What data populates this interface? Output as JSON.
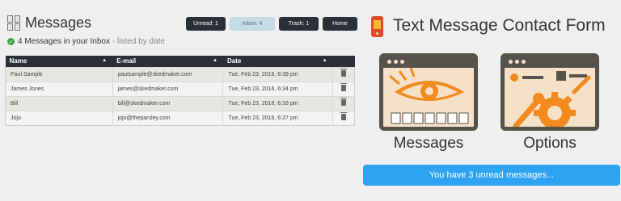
{
  "header": {
    "title": "Messages"
  },
  "nav": {
    "unread": "Unread: 1",
    "inbox": "Inbox: 4",
    "trash": "Trash: 1",
    "home": "Home"
  },
  "status": {
    "main": "4 Messages in your Inbox",
    "suffix": "- listed by date"
  },
  "table": {
    "columns": [
      "Name",
      "E-mail",
      "Date"
    ],
    "rows": [
      {
        "name": "Paul Sample",
        "email": "paulsample@skedmaker.com",
        "date": "Tue, Feb 23, 2016, 6:39 pm"
      },
      {
        "name": "James Jones",
        "email": "james@skedmaker.com",
        "date": "Tue, Feb 23, 2016, 6:34 pm"
      },
      {
        "name": "Bill",
        "email": "bill@skedmaker.com",
        "date": "Tue, Feb 23, 2016, 6:33 pm"
      },
      {
        "name": "Jojo",
        "email": "jojo@theparsley.com",
        "date": "Tue, Feb 23, 2016, 6:27 pm"
      }
    ]
  },
  "side": {
    "title": "Text Message Contact Form",
    "tiles": [
      {
        "label": "Messages",
        "icon": "eye-envelopes-icon"
      },
      {
        "label": "Options",
        "icon": "gears-icon"
      }
    ],
    "notice": "You have 3 unread messages..."
  },
  "colors": {
    "dark": "#2b3038",
    "accent_blue": "#2ea3f2",
    "orange": "#f28a1e",
    "tile_bg": "#f5e0c8",
    "success": "#40a345"
  }
}
